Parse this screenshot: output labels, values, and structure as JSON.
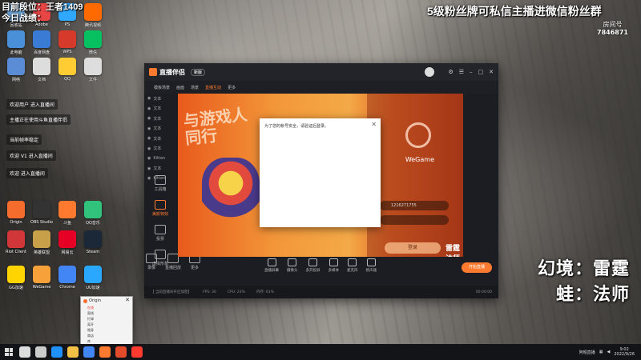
{
  "overlays": {
    "rank_line": "目前段位：王者1409",
    "today_line": "今日战绩：",
    "top_banner": "5级粉丝牌可私信主播进微信粉丝群",
    "room_label": "房间号",
    "room_number": "7846871",
    "illusion": "幻境：雷霆",
    "frog": "蛙：法师"
  },
  "chat_messages": [
    {
      "text": "欢迎用户 进入直播间",
      "highlight": ""
    },
    {
      "text": "主播正在使用斗鱼直播伴侣",
      "highlight": ""
    },
    {
      "text": "当前帧率稳定",
      "highlight": ""
    },
    {
      "text": "欢迎 V1 进入直播间",
      "highlight": "V1"
    },
    {
      "text": "欢迎 进入直播间",
      "highlight": ""
    }
  ],
  "desktop_icons": [
    {
      "name": "recycle-bin-icon",
      "label": "回收站",
      "color": "#6fa8dc"
    },
    {
      "name": "folder-icon",
      "label": "Adobe",
      "color": "#e84545"
    },
    {
      "name": "app-icon",
      "label": "PS",
      "color": "#31a8ff"
    },
    {
      "name": "app-icon",
      "label": "腾讯视频",
      "color": "#ff6a00"
    },
    {
      "name": "app-icon",
      "label": "此电脑",
      "color": "#4a90d9"
    },
    {
      "name": "app-icon",
      "label": "百度网盘",
      "color": "#3a7bd5"
    },
    {
      "name": "app-icon",
      "label": "WPS",
      "color": "#d63a2a"
    },
    {
      "name": "app-icon",
      "label": "微信",
      "color": "#07c160"
    },
    {
      "name": "app-icon",
      "label": "网络",
      "color": "#5b8dd6"
    },
    {
      "name": "app-icon",
      "label": "文档",
      "color": "#dddddd"
    },
    {
      "name": "app-icon",
      "label": "QQ",
      "color": "#ffcc33"
    },
    {
      "name": "app-icon",
      "label": "文件",
      "color": "#dddddd"
    },
    {
      "name": "app-icon",
      "label": "Origin",
      "color": "#f56c2d"
    },
    {
      "name": "app-icon",
      "label": "OBS Studio",
      "color": "#333333"
    },
    {
      "name": "app-icon",
      "label": "斗鱼",
      "color": "#ff7a2e"
    },
    {
      "name": "app-icon",
      "label": "QQ音乐",
      "color": "#31c27c"
    },
    {
      "name": "app-icon",
      "label": "Riot Client",
      "color": "#d13639"
    },
    {
      "name": "app-icon",
      "label": "英雄联盟",
      "color": "#c8a04a"
    },
    {
      "name": "app-icon",
      "label": "网易云",
      "color": "#e60026"
    },
    {
      "name": "app-icon",
      "label": "Steam",
      "color": "#1b2838"
    },
    {
      "name": "app-icon",
      "label": "GG加速",
      "color": "#ffd400"
    },
    {
      "name": "app-icon",
      "label": "WeGame",
      "color": "#f7a13a"
    },
    {
      "name": "app-icon",
      "label": "Chrome",
      "color": "#4285f4"
    },
    {
      "name": "app-icon",
      "label": "UU加速",
      "color": "#2aa7ff"
    }
  ],
  "app": {
    "name": "直播伴侣",
    "version": "新版",
    "toolbar_tabs": [
      "模板场景",
      "画面",
      "场景",
      "直播互动",
      "更多"
    ],
    "active_tab_index": 3,
    "scenes": [
      "文本",
      "文本",
      "文本",
      "文本",
      "文本",
      "文本",
      "Kitten",
      "文本",
      "Kitten"
    ],
    "left_tools": [
      {
        "name": "tool-icon",
        "label": "工具箱"
      },
      {
        "name": "beauty-icon",
        "label": "美颜特效"
      },
      {
        "name": "vote-icon",
        "label": "投票"
      },
      {
        "name": "reward-icon",
        "label": "虚拟形象"
      }
    ],
    "row2_tools": [
      "录像",
      "直播回放",
      "更多"
    ],
    "controls": [
      "直播屏幕",
      "摄像头",
      "多开投屏",
      "多媒体",
      "麦克风",
      "扬声器"
    ],
    "start_button": "开始直播",
    "status_left": "【 当前直播间开启加密】",
    "status_items": [
      "FPS: 30",
      "CPU: 23%",
      "内存: 61%"
    ],
    "status_time": "00:00:00"
  },
  "modal": {
    "message": "为了您的帐号安全，请验证后登录。",
    "close": "✕"
  },
  "wegame": {
    "name": "WeGame",
    "account_field": "1216271755",
    "password_field": "",
    "login_button": "登录",
    "footer": "忘记密码 | 注册"
  },
  "preview_overlay": {
    "line1": "雷霆",
    "line2": "法师",
    "title_line1": "与游戏人",
    "title_line2": "同行"
  },
  "origin_window": {
    "title": "Origin",
    "items": [
      "在线",
      "离线",
      "忙碌",
      "离开",
      "隐身",
      "商店",
      "库",
      "帮助"
    ],
    "highlight": "在线"
  },
  "taskbar": {
    "tray_text": "阿昭直播",
    "time": "9:02",
    "date": "2022/9/26",
    "apps": [
      {
        "name": "search-icon",
        "color": "#dddddd"
      },
      {
        "name": "taskview-icon",
        "color": "#cccccc"
      },
      {
        "name": "edge-icon",
        "color": "#1e90ff"
      },
      {
        "name": "explorer-icon",
        "color": "#f3c145"
      },
      {
        "name": "chrome-icon",
        "color": "#4285f4"
      },
      {
        "name": "game-icon",
        "color": "#ff7a2e"
      },
      {
        "name": "browser-icon",
        "color": "#e44b2a"
      },
      {
        "name": "record-icon",
        "color": "#ff3b30"
      }
    ]
  }
}
